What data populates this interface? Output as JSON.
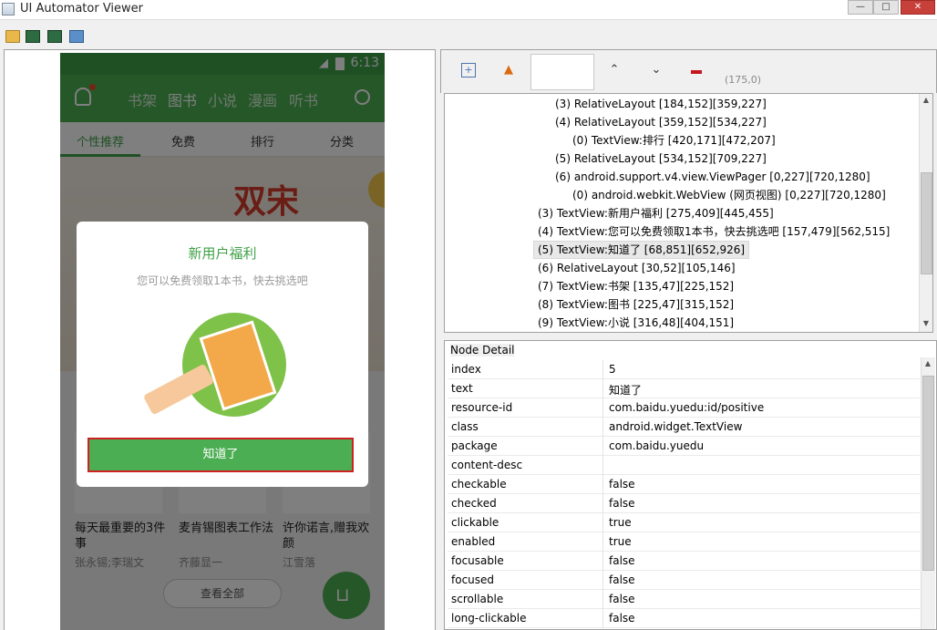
{
  "window": {
    "title": "UI Automator Viewer"
  },
  "window_buttons": [
    "—",
    "□",
    "✕"
  ],
  "toolbar": [
    "open-icon",
    "device-screenshot-icon",
    "device-screenshot-compressed-icon",
    "save-icon"
  ],
  "phone": {
    "status": {
      "time": "6:13"
    },
    "nav": [
      "书架",
      "图书",
      "小说",
      "漫画",
      "听书"
    ],
    "subtabs": [
      "个性推荐",
      "免费",
      "排行",
      "分类"
    ],
    "books": [
      {
        "title": "每天最重要的3件事",
        "author": "张永锡;李瑞文"
      },
      {
        "title": "麦肯锡图表工作法",
        "author": "齐藤显一"
      },
      {
        "title": "许你诺言,赠我欢颜",
        "author": "江雪落"
      }
    ],
    "view_all": "查看全部",
    "dialog": {
      "title": "新用户福利",
      "message": "您可以免费领取1本书，快去挑选吧",
      "button": "知道了"
    }
  },
  "node_toolbar": {
    "coords": "(175,0)"
  },
  "tree": [
    {
      "text": "(3) RelativeLayout [184,152][359,227]",
      "indent": 2
    },
    {
      "text": "(4) RelativeLayout [359,152][534,227]",
      "indent": 2
    },
    {
      "text": "(0) TextView:排行 [420,171][472,207]",
      "indent": 3
    },
    {
      "text": "(5) RelativeLayout [534,152][709,227]",
      "indent": 2
    },
    {
      "text": "(6) android.support.v4.view.ViewPager [0,227][720,1280]",
      "indent": 2
    },
    {
      "text": "(0) android.webkit.WebView (网页视图) [0,227][720,1280]",
      "indent": 3
    },
    {
      "text": "(3) TextView:新用户福利 [275,409][445,455]",
      "indent": 1
    },
    {
      "text": "(4) TextView:您可以免费领取1本书，快去挑选吧 [157,479][562,515]",
      "indent": 1
    },
    {
      "text": "(5) TextView:知道了 [68,851][652,926]",
      "indent": 1,
      "selected": true
    },
    {
      "text": "(6) RelativeLayout [30,52][105,146]",
      "indent": 1
    },
    {
      "text": "(7) TextView:书架 [135,47][225,152]",
      "indent": 1
    },
    {
      "text": "(8) TextView:图书 [225,47][315,152]",
      "indent": 1
    },
    {
      "text": "(9) TextView:小说 [316,48][404,151]",
      "indent": 1
    }
  ],
  "node_detail": {
    "label": "Node Detail",
    "rows": [
      {
        "key": "index",
        "value": "5"
      },
      {
        "key": "text",
        "value": "知道了"
      },
      {
        "key": "resource-id",
        "value": "com.baidu.yuedu:id/positive"
      },
      {
        "key": "class",
        "value": "android.widget.TextView"
      },
      {
        "key": "package",
        "value": "com.baidu.yuedu"
      },
      {
        "key": "content-desc",
        "value": ""
      },
      {
        "key": "checkable",
        "value": "false"
      },
      {
        "key": "checked",
        "value": "false"
      },
      {
        "key": "clickable",
        "value": "true"
      },
      {
        "key": "enabled",
        "value": "true"
      },
      {
        "key": "focusable",
        "value": "false"
      },
      {
        "key": "focused",
        "value": "false"
      },
      {
        "key": "scrollable",
        "value": "false"
      },
      {
        "key": "long-clickable",
        "value": "false"
      }
    ]
  }
}
